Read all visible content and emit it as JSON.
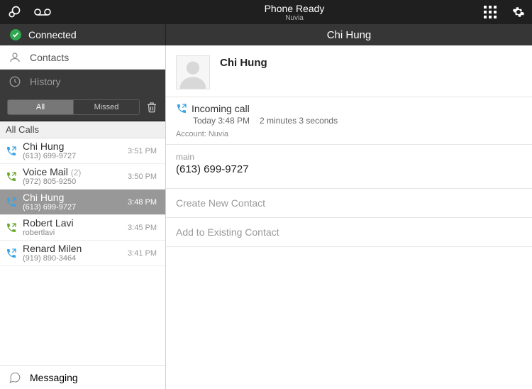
{
  "header": {
    "title": "Phone Ready",
    "subtitle": "Nuvia"
  },
  "statusbar": {
    "connected_label": "Connected",
    "detail_title": "Chi Hung"
  },
  "sidebar": {
    "contacts_label": "Contacts",
    "history_label": "History",
    "messaging_label": "Messaging",
    "filter": {
      "all": "All",
      "missed": "Missed"
    },
    "list_header": "All Calls",
    "calls": [
      {
        "name": "Chi Hung",
        "sub": "(613) 699-9727",
        "time": "3:51 PM",
        "direction": "incoming",
        "selected": false
      },
      {
        "name": "Voice Mail",
        "count": "(2)",
        "sub": "(972) 805-9250",
        "time": "3:50 PM",
        "direction": "outgoing",
        "selected": false
      },
      {
        "name": "Chi Hung",
        "sub": "(613) 699-9727",
        "time": "3:48 PM",
        "direction": "incoming",
        "selected": true
      },
      {
        "name": "Robert Lavi",
        "sub": "robertlavi",
        "time": "3:45 PM",
        "direction": "outgoing",
        "selected": false
      },
      {
        "name": "Renard Milen",
        "sub": "(919) 890-3464",
        "time": "3:41 PM",
        "direction": "incoming",
        "selected": false
      }
    ]
  },
  "detail": {
    "name": "Chi Hung",
    "call_type": "Incoming call",
    "timestamp": "Today 3:48 PM",
    "duration": "2 minutes 3 seconds",
    "account_label": "Account: Nuvia",
    "phone_label": "main",
    "phone_number": "(613) 699-9727",
    "action_create": "Create New Contact",
    "action_add": "Add to Existing Contact"
  },
  "colors": {
    "incoming": "#3aa3e3",
    "outgoing": "#6aa82b",
    "connected": "#2fa84f"
  }
}
